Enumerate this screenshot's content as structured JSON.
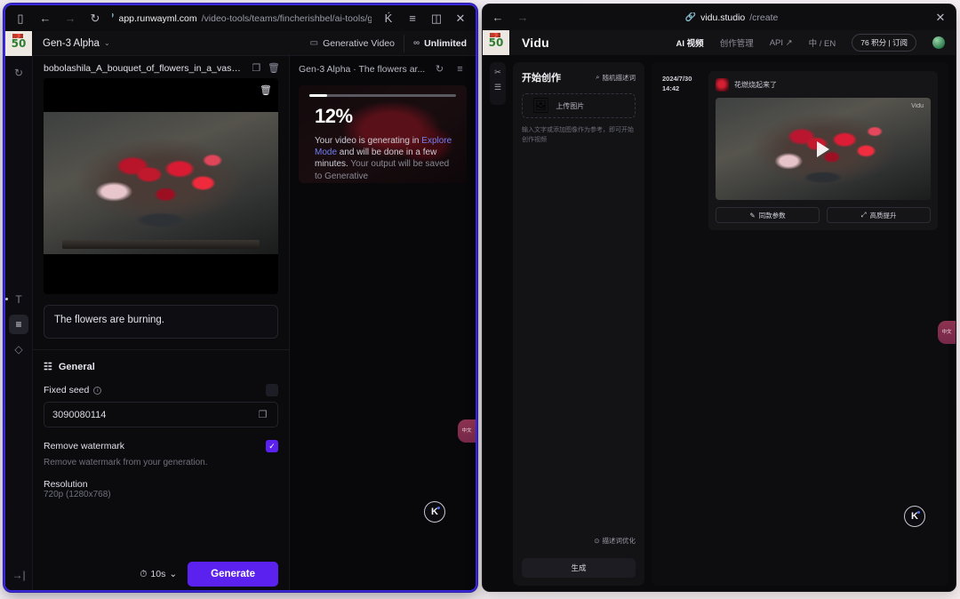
{
  "left_window": {
    "browser": {
      "sidebar_toggle_icon": "panel-icon",
      "back_label": "←",
      "forward_label": "→",
      "reload_label": "↻",
      "link_icon": "🔗",
      "url_host": "app.runwayml.com",
      "url_path": "/video-tools/teams/fincherishbel/ai-tools/g...",
      "k_label": "Ḱ",
      "reader_label": "≡",
      "split_label": "◫",
      "close_label": "✕"
    },
    "app": {
      "logo_text": "50",
      "model_name": "Gen-3 Alpha",
      "model_chevron": "⌄",
      "folder_icon": "▭",
      "generative_video_label": "Generative Video",
      "unlimited_icon": "∞",
      "unlimited_label": "Unlimited"
    },
    "rail": [
      {
        "name": "history-icon",
        "glyph": "↻"
      },
      {
        "name": "text-tool-icon",
        "glyph": "T"
      },
      {
        "name": "settings-sliders-icon",
        "glyph": "≡"
      },
      {
        "name": "layers-icon",
        "glyph": "◇"
      },
      {
        "name": "expand-panel-icon",
        "glyph": "→|"
      }
    ],
    "asset": {
      "filename": "bobolashila_A_bouquet_of_flowers_in_a_vase_still_li..",
      "crop_icon": "❐",
      "delete_icon": "🗑",
      "image_delete_icon": "🗑"
    },
    "prompt": {
      "text": "The flowers are burning."
    },
    "settings": {
      "section_title": "General",
      "section_icon": "☷",
      "fixed_seed_label": "Fixed seed",
      "fixed_seed_info": "i",
      "fixed_seed_toggle": "off",
      "seed_value": "3090080114",
      "seed_copy_icon": "❐",
      "remove_watermark_label": "Remove watermark",
      "remove_watermark_sub": "Remove watermark from your generation.",
      "remove_watermark_toggle": "on",
      "remove_watermark_check": "✓",
      "resolution_label": "Resolution",
      "resolution_value": "720p (1280x768)"
    },
    "footer": {
      "duration_icon": "⏱",
      "duration_label": "10s",
      "duration_chevron": "⌄",
      "generate_label": "Generate"
    },
    "preview": {
      "title": "Gen-3 Alpha · The flowers ar...",
      "refresh_icon": "↻",
      "menu_icon": "≡",
      "progress_percent": "12%",
      "progress_value": 12,
      "status_line_1": "Your video is generating in ",
      "status_link": "Explore Mode",
      "status_line_2": " and will be done in a few minutes.",
      "status_line_3": "Your output will be saved to Generative"
    },
    "float": {
      "tab_text": "中文",
      "badge_text": "K"
    }
  },
  "right_window": {
    "browser": {
      "back_label": "←",
      "forward_label": "→",
      "link_icon": "🔗",
      "url_host": "vidu.studio",
      "url_path": "/create",
      "close_label": "✕"
    },
    "app": {
      "logo_text": "50",
      "brand": "Vidu",
      "nav": [
        {
          "label": "AI 视频",
          "active": true
        },
        {
          "label": "创作管理",
          "active": false
        },
        {
          "label": "API ↗",
          "active": false
        },
        {
          "label": "中 / EN",
          "active": false
        }
      ],
      "credits_badge": "76 积分 | 订阅",
      "avatar": "avatar"
    },
    "rail": [
      {
        "name": "share-icon",
        "glyph": "✂"
      },
      {
        "name": "list-icon",
        "glyph": "☰"
      }
    ],
    "create_panel": {
      "title": "开始创作",
      "random_icon": "⌕",
      "random_label": "随机描述词",
      "upload_icon": "🖼",
      "upload_label": "上传图片",
      "hint": "输入文字或添加图像作为参考，即可开始创作视频",
      "optimize_icon": "⊙",
      "optimize_label": "描述词优化",
      "generate_label": "生成"
    },
    "feed": {
      "date": "2024/7/30",
      "time": "14:42",
      "card_title": "花燃烧起来了",
      "watermark": "Vidu",
      "play_icon": "play-icon",
      "side_actions": [
        {
          "name": "favorite-icon",
          "glyph": "☆"
        },
        {
          "name": "like-icon",
          "glyph": "ὄd"
        },
        {
          "name": "comment-icon",
          "glyph": "○"
        },
        {
          "name": "share-icon",
          "glyph": "≺"
        },
        {
          "name": "more-icon",
          "glyph": "⋯"
        }
      ],
      "buttons": [
        {
          "icon": "✎",
          "label": "同款参数"
        },
        {
          "icon": "⤢",
          "label": "高质提升"
        }
      ]
    },
    "float": {
      "tab_text": "中文",
      "badge_text": "K"
    }
  },
  "colors": {
    "accent_purple": "#5b21ef",
    "window_border_blue": "#3a27d8",
    "link_blue": "#6f7ff0",
    "badge_maroon": "#8c3350"
  }
}
